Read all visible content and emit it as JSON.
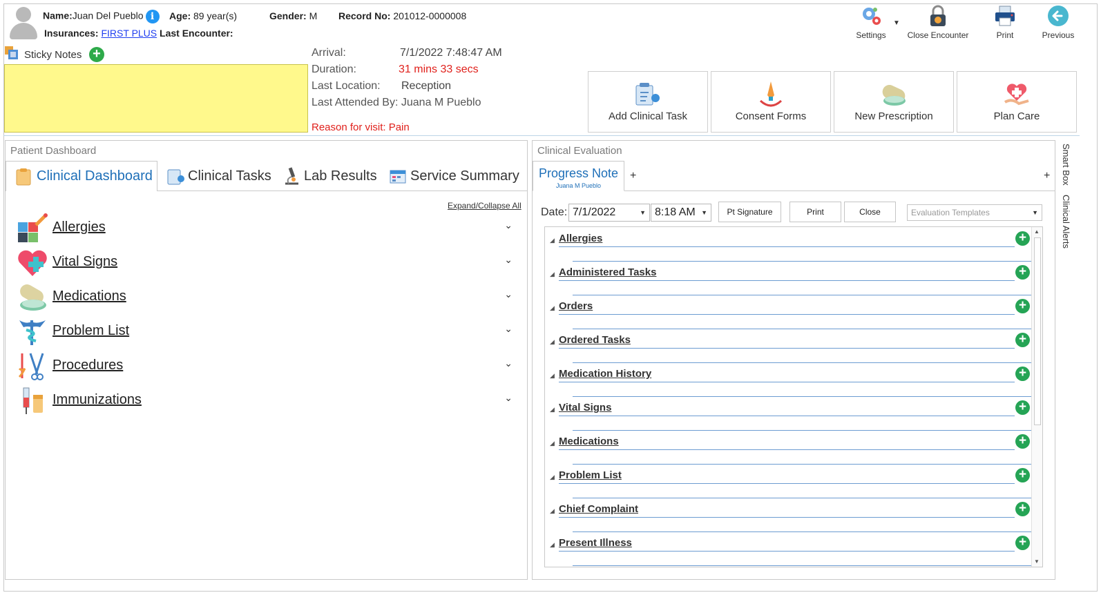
{
  "patient": {
    "name_label": "Name:",
    "name": "Juan Del Pueblo",
    "age_label": "Age:",
    "age": "89 year(s)",
    "gender_label": "Gender:",
    "gender": "M",
    "record_label": "Record No:",
    "record": "201012-0000008",
    "insurances_label": "Insurances:",
    "insurance": "FIRST PLUS",
    "last_encounter_label": "Last Encounter:"
  },
  "toolbar": {
    "settings": "Settings",
    "close_encounter": "Close Encounter",
    "print": "Print",
    "previous": "Previous"
  },
  "sticky": {
    "label": "Sticky Notes"
  },
  "encounter": {
    "arrival_label": "Arrival:",
    "arrival": "7/1/2022 7:48:47 AM",
    "duration_label": "Duration:",
    "duration": "31 mins 33 secs",
    "location_label": "Last Location:",
    "location": "Reception",
    "attended_label": "Last Attended By:",
    "attended": "Juana M Pueblo",
    "reason": "Reason for visit: Pain"
  },
  "actions": {
    "add_clinical_task": "Add Clinical Task",
    "consent_forms": "Consent Forms",
    "new_prescription": "New Prescription",
    "plan_care": "Plan Care"
  },
  "dashboard": {
    "title": "Patient Dashboard",
    "tabs": [
      "Clinical Dashboard",
      "Clinical Tasks",
      "Lab Results",
      "Service Summary"
    ],
    "expand_collapse": "Expand/Collapse All",
    "items": [
      "Allergies",
      "Vital Signs",
      "Medications",
      "Problem List",
      "Procedures",
      "Immunizations"
    ]
  },
  "evaluation": {
    "title": "Clinical Evaluation",
    "tab_title": "Progress Note",
    "tab_author": "Juana M Pueblo",
    "date_label": "Date:",
    "date": "7/1/2022",
    "time": "8:18 AM",
    "pt_signature": "Pt Signature",
    "print": "Print",
    "close": "Close",
    "templates_placeholder": "Evaluation Templates",
    "sections": [
      "Allergies",
      "Administered Tasks",
      "Orders",
      "Ordered Tasks",
      "Medication History",
      "Vital Signs",
      "Medications",
      "Problem List",
      "Chief Complaint",
      "Present Illness"
    ]
  },
  "side_tabs": {
    "smart_box": "Smart Box",
    "clinical_alerts": "Clinical Alerts"
  },
  "colors": {
    "accent": "#1e6fb8",
    "sticky": "#fff98c",
    "alert_red": "#e0201b",
    "plus_green": "#25a455"
  }
}
